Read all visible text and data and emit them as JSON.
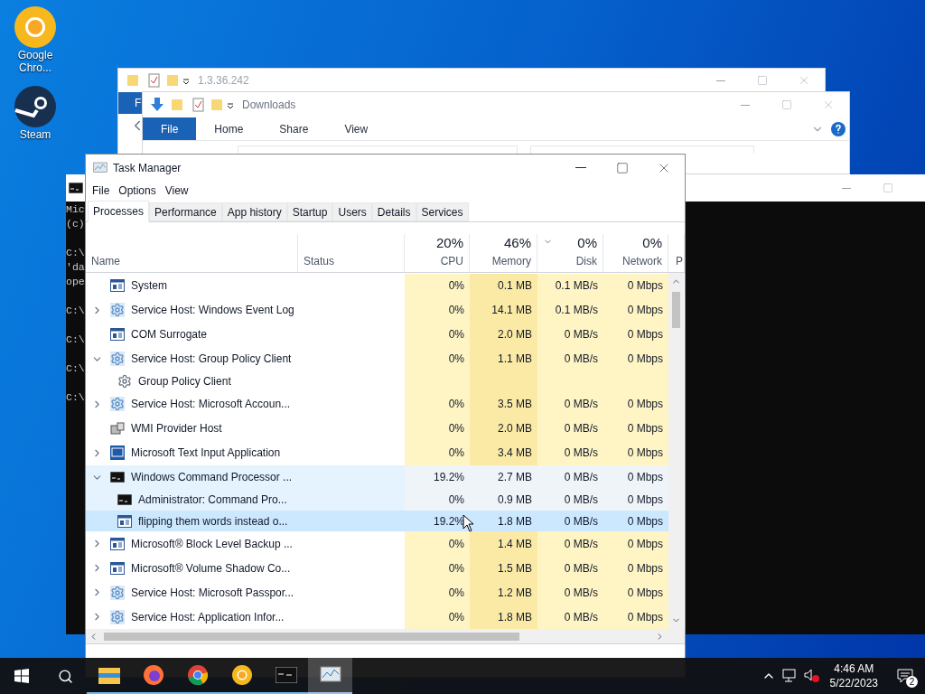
{
  "desktop_icons": [
    {
      "kind": "chrome-canary",
      "label": "Google Chro..."
    },
    {
      "kind": "steam",
      "label": "Steam"
    }
  ],
  "explorer_back": {
    "title": "1.3.36.242",
    "ribbon_tab": "F"
  },
  "explorer_front": {
    "title": "Downloads",
    "ribbon_tabs": [
      {
        "label": "File",
        "selected": true
      },
      {
        "label": "Home",
        "selected": false
      },
      {
        "label": "Share",
        "selected": false
      },
      {
        "label": "View",
        "selected": false
      }
    ]
  },
  "console": {
    "paragraphs": [
      [
        "Mic",
        "(c)"
      ],
      [
        "C:\\",
        "'da",
        "ope"
      ],
      [
        "C:\\"
      ],
      [
        "C:\\"
      ],
      [
        "C:\\"
      ],
      [
        "C:\\"
      ]
    ]
  },
  "task_manager": {
    "title": "Task Manager",
    "menu": [
      "File",
      "Options",
      "View"
    ],
    "tabs": [
      {
        "label": "Processes",
        "selected": true
      },
      {
        "label": "Performance",
        "selected": false
      },
      {
        "label": "App history",
        "selected": false
      },
      {
        "label": "Startup",
        "selected": false
      },
      {
        "label": "Users",
        "selected": false
      },
      {
        "label": "Details",
        "selected": false
      },
      {
        "label": "Services",
        "selected": false
      }
    ],
    "columns": [
      {
        "label": "Name"
      },
      {
        "label": "Status"
      },
      {
        "percent": "20%",
        "label": "CPU",
        "sorted": false
      },
      {
        "percent": "46%",
        "label": "Memory",
        "sorted": false
      },
      {
        "percent": "0%",
        "label": "Disk",
        "sorted": true
      },
      {
        "percent": "0%",
        "label": "Network",
        "sorted": false
      },
      {
        "label": "P"
      }
    ],
    "rows": [
      {
        "name": "System",
        "kind": "window",
        "selected": false,
        "hovered": false,
        "cpu": "0%",
        "memory": "0.1 MB",
        "disk": "0.1 MB/s",
        "network": "0 Mbps"
      },
      {
        "name": "Service Host: Windows Event Log",
        "kind": "service",
        "expanded": false,
        "selected": false,
        "hovered": false,
        "cpu": "0%",
        "memory": "14.1 MB",
        "disk": "0.1 MB/s",
        "network": "0 Mbps"
      },
      {
        "name": "COM Surrogate",
        "kind": "window",
        "selected": false,
        "hovered": false,
        "cpu": "0%",
        "memory": "2.0 MB",
        "disk": "0 MB/s",
        "network": "0 Mbps"
      },
      {
        "name": "Service Host: Group Policy Client",
        "kind": "service",
        "expanded": true,
        "selected": false,
        "hovered": false,
        "cpu": "0%",
        "memory": "1.1 MB",
        "disk": "0 MB/s",
        "network": "0 Mbps",
        "children": [
          {
            "name": "Group Policy Client",
            "kind": "subservice",
            "selected": false,
            "hovered": false
          }
        ]
      },
      {
        "name": "Service Host: Microsoft Accoun...",
        "kind": "service",
        "expanded": false,
        "selected": false,
        "hovered": false,
        "cpu": "0%",
        "memory": "3.5 MB",
        "disk": "0 MB/s",
        "network": "0 Mbps"
      },
      {
        "name": "WMI Provider Host",
        "kind": "computer",
        "selected": false,
        "hovered": false,
        "cpu": "0%",
        "memory": "2.0 MB",
        "disk": "0 MB/s",
        "network": "0 Mbps"
      },
      {
        "name": "Microsoft Text Input Application",
        "kind": "app",
        "expanded": false,
        "selected": false,
        "hovered": false,
        "cpu": "0%",
        "memory": "3.4 MB",
        "disk": "0 MB/s",
        "network": "0 Mbps"
      },
      {
        "name": "Windows Command Processor ...",
        "kind": "console",
        "expanded": true,
        "selected": false,
        "hovered": true,
        "cpu": "19.2%",
        "memory": "2.7 MB",
        "disk": "0 MB/s",
        "network": "0 Mbps",
        "children": [
          {
            "name": "Administrator:  Command Pro...",
            "kind": "console",
            "selected": false,
            "hovered": true,
            "cpu": "0%",
            "memory": "0.9 MB",
            "disk": "0 MB/s",
            "network": "0 Mbps"
          },
          {
            "name": "flipping them words instead o...",
            "kind": "window",
            "selected": true,
            "hovered": false,
            "cpu": "19.2%",
            "memory": "1.8 MB",
            "disk": "0 MB/s",
            "network": "0 Mbps"
          }
        ]
      },
      {
        "name": "Microsoft® Block Level Backup ...",
        "kind": "window",
        "expanded": false,
        "selected": false,
        "hovered": false,
        "cpu": "0%",
        "memory": "1.4 MB",
        "disk": "0 MB/s",
        "network": "0 Mbps"
      },
      {
        "name": "Microsoft® Volume Shadow Co...",
        "kind": "window",
        "expanded": false,
        "selected": false,
        "hovered": false,
        "cpu": "0%",
        "memory": "1.5 MB",
        "disk": "0 MB/s",
        "network": "0 Mbps"
      },
      {
        "name": "Service Host: Microsoft Passpor...",
        "kind": "service",
        "expanded": false,
        "selected": false,
        "hovered": false,
        "cpu": "0%",
        "memory": "1.2 MB",
        "disk": "0 MB/s",
        "network": "0 Mbps"
      },
      {
        "name": "Service Host: Application Infor...",
        "kind": "service",
        "expanded": false,
        "selected": false,
        "hovered": false,
        "cpu": "0%",
        "memory": "1.8 MB",
        "disk": "0 MB/s",
        "network": "0 Mbps"
      }
    ]
  },
  "taskbar": {
    "apps": [
      {
        "kind": "explorer",
        "selected": false
      },
      {
        "kind": "firefox",
        "selected": false
      },
      {
        "kind": "chrome",
        "selected": false
      },
      {
        "kind": "chrome-canary",
        "selected": false
      },
      {
        "kind": "console",
        "selected": false
      },
      {
        "kind": "taskmanager",
        "selected": true
      }
    ],
    "time": "4:46 AM",
    "date": "5/22/2023",
    "notifications": "2"
  }
}
